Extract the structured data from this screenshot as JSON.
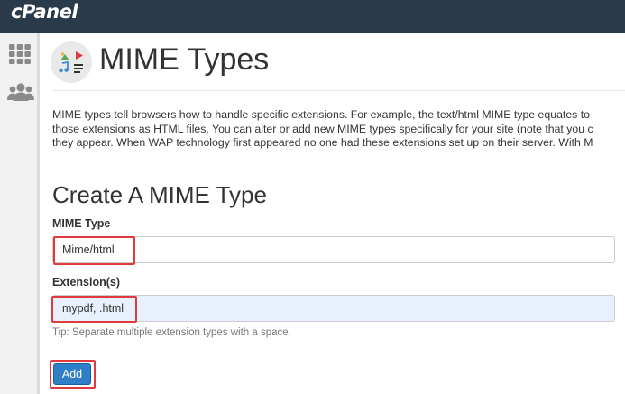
{
  "brand": {
    "logo_text": "cPanel"
  },
  "sidebar": {
    "items": [
      {
        "icon": "grid-icon",
        "label": "Home"
      },
      {
        "icon": "users-icon",
        "label": "User Manager"
      }
    ]
  },
  "page": {
    "title": "MIME Types",
    "icon": "mime-types-icon",
    "description_lines": [
      "MIME types tell browsers how to handle specific extensions. For example, the text/html MIME type equates to",
      "those extensions as HTML files. You can alter or add new MIME types specifically for your site (note that you c",
      "they appear. When WAP technology first appeared no one had these extensions set up on their server. With M"
    ]
  },
  "form": {
    "section_title": "Create A MIME Type",
    "mime_type": {
      "label": "MIME Type",
      "value": "Mime/html"
    },
    "extensions": {
      "label": "Extension(s)",
      "value": "mypdf, .html"
    },
    "tip": "Tip: Separate multiple extension types with a space.",
    "add_label": "Add"
  },
  "colors": {
    "topbar": "#293a4a",
    "highlight": "#e0393e",
    "primary_button": "#2f7fc8"
  }
}
